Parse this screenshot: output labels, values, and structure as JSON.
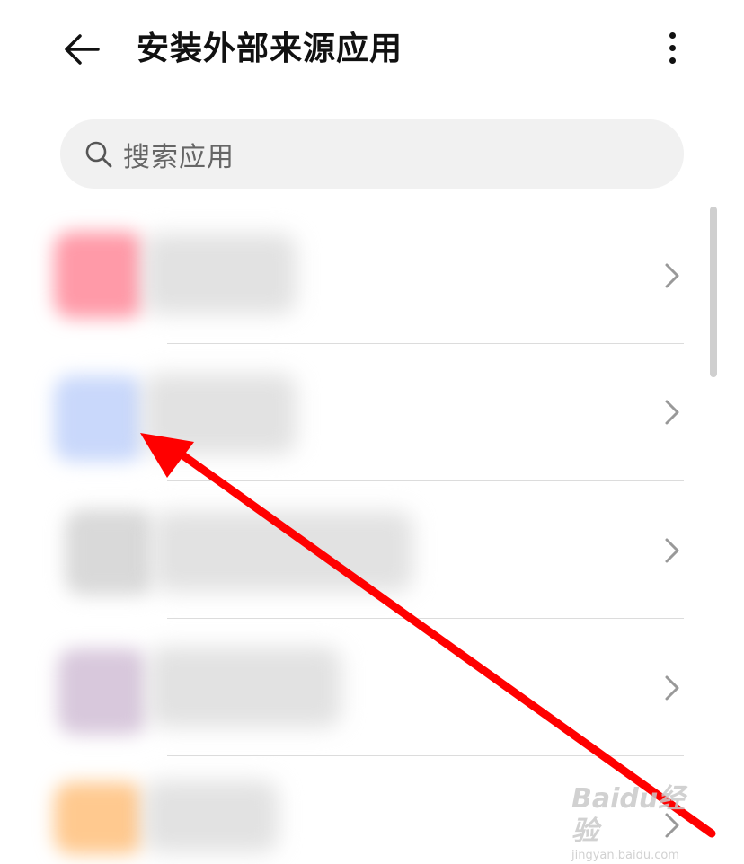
{
  "header": {
    "title": "安装外部来源应用",
    "back_icon": "arrow-left-icon",
    "more_icon": "more-vertical-icon"
  },
  "search": {
    "placeholder": "搜索应用",
    "icon": "search-icon"
  },
  "list": {
    "items": [
      {
        "icon_color": "#ff9aa8",
        "chevron_icon": "chevron-right-icon"
      },
      {
        "icon_color": "#c9d8fb",
        "chevron_icon": "chevron-right-icon"
      },
      {
        "icon_color": "#d9d9d9",
        "chevron_icon": "chevron-right-icon"
      },
      {
        "icon_color": "#d8c8dc",
        "chevron_icon": "chevron-right-icon"
      },
      {
        "icon_color": "#ffc98f",
        "chevron_icon": "chevron-right-icon"
      }
    ]
  },
  "annotation": {
    "arrow_color": "#ff0000"
  },
  "watermark": {
    "main": "Baidu经验",
    "sub": "jingyan.baidu.com"
  }
}
